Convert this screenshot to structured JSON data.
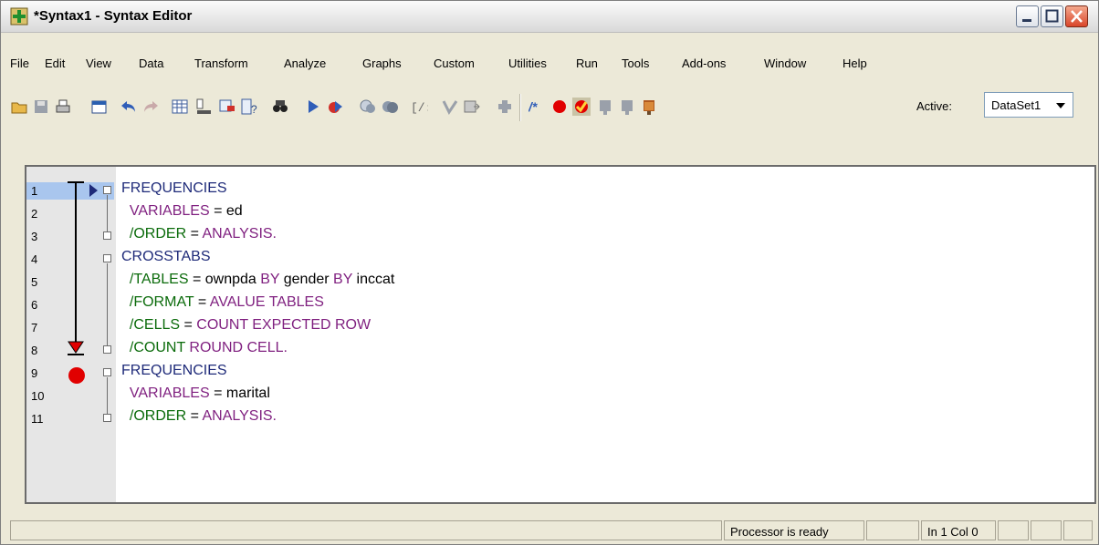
{
  "window": {
    "title": "*Syntax1 - Syntax Editor"
  },
  "menu": {
    "items": [
      {
        "label": "File"
      },
      {
        "label": "Edit"
      },
      {
        "label": "View"
      },
      {
        "label": "Data"
      },
      {
        "label": "Transform"
      },
      {
        "label": "Analyze"
      },
      {
        "label": "Graphs"
      },
      {
        "label": "Custom"
      },
      {
        "label": "Utilities"
      },
      {
        "label": "Run"
      },
      {
        "label": "Tools"
      },
      {
        "label": "Add-ons"
      },
      {
        "label": "Window"
      },
      {
        "label": "Help"
      }
    ]
  },
  "toolbar": {
    "active_label": "Active:",
    "dataset_value": "DataSet1",
    "icons": [
      "open-icon",
      "save-icon",
      "print-icon",
      "dialog-recall-icon",
      "undo-icon",
      "redo-icon",
      "goto-case-icon",
      "goto-variable-icon",
      "insert-case-icon",
      "variable-info-icon",
      "find-icon",
      "run-selection-icon",
      "run-to-end-icon",
      "bookmark-icon",
      "bookmark-next-icon",
      "indent-icon",
      "comment-icon",
      "uncomment-icon",
      "add-icon",
      "toggle-comment-icon",
      "breakpoint-icon",
      "toggle-breakpoint-icon",
      "step-icon",
      "step-over-icon",
      "continue-icon"
    ]
  },
  "editor": {
    "line_numbers": [
      "1",
      "2",
      "3",
      "4",
      "5",
      "6",
      "7",
      "8",
      "9",
      "10",
      "11"
    ],
    "lines": [
      {
        "segments": [
          {
            "t": "FREQUENCIES",
            "c": "blue"
          }
        ]
      },
      {
        "segments": [
          {
            "t": "  VARIABLES",
            "c": "purple"
          },
          {
            "t": " = ed",
            "c": "black"
          }
        ]
      },
      {
        "segments": [
          {
            "t": "  /ORDER",
            "c": "green"
          },
          {
            "t": " = ",
            "c": "black"
          },
          {
            "t": "ANALYSIS.",
            "c": "purple"
          }
        ]
      },
      {
        "segments": [
          {
            "t": "CROSSTABS",
            "c": "blue"
          }
        ]
      },
      {
        "segments": [
          {
            "t": "  /TABLES",
            "c": "green"
          },
          {
            "t": " = ownpda ",
            "c": "black"
          },
          {
            "t": "BY",
            "c": "purple"
          },
          {
            "t": " gender ",
            "c": "black"
          },
          {
            "t": "BY",
            "c": "purple"
          },
          {
            "t": " inccat",
            "c": "black"
          }
        ]
      },
      {
        "segments": [
          {
            "t": "  /FORMAT",
            "c": "green"
          },
          {
            "t": " = ",
            "c": "black"
          },
          {
            "t": "AVALUE TABLES",
            "c": "purple"
          }
        ]
      },
      {
        "segments": [
          {
            "t": "  /CELLS",
            "c": "green"
          },
          {
            "t": " = ",
            "c": "black"
          },
          {
            "t": "COUNT EXPECTED ROW",
            "c": "purple"
          }
        ]
      },
      {
        "segments": [
          {
            "t": "  /COUNT",
            "c": "green"
          },
          {
            "t": " ",
            "c": "black"
          },
          {
            "t": "ROUND CELL.",
            "c": "purple"
          }
        ]
      },
      {
        "segments": [
          {
            "t": "FREQUENCIES",
            "c": "blue"
          }
        ]
      },
      {
        "segments": [
          {
            "t": "  VARIABLES",
            "c": "purple"
          },
          {
            "t": " = marital",
            "c": "black"
          }
        ]
      },
      {
        "segments": [
          {
            "t": "  /ORDER",
            "c": "green"
          },
          {
            "t": " = ",
            "c": "black"
          },
          {
            "t": "ANALYSIS.",
            "c": "purple"
          }
        ]
      }
    ],
    "breakpoint_line": "9",
    "current_line": "1"
  },
  "status": {
    "processor": "Processor is ready",
    "position": "In 1 Col 0"
  }
}
